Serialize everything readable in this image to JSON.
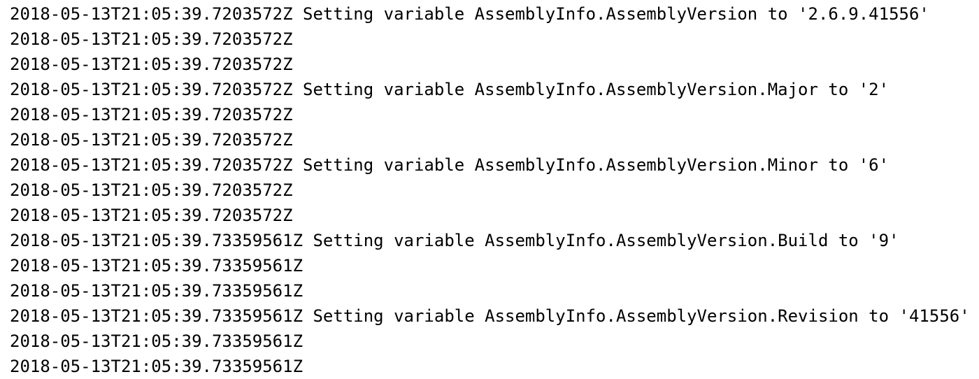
{
  "log": {
    "lines": [
      "2018-05-13T21:05:39.7203572Z Setting variable AssemblyInfo.AssemblyVersion to '2.6.9.41556'",
      "2018-05-13T21:05:39.7203572Z",
      "2018-05-13T21:05:39.7203572Z",
      "2018-05-13T21:05:39.7203572Z Setting variable AssemblyInfo.AssemblyVersion.Major to '2'",
      "2018-05-13T21:05:39.7203572Z",
      "2018-05-13T21:05:39.7203572Z",
      "2018-05-13T21:05:39.7203572Z Setting variable AssemblyInfo.AssemblyVersion.Minor to '6'",
      "2018-05-13T21:05:39.7203572Z",
      "2018-05-13T21:05:39.7203572Z",
      "2018-05-13T21:05:39.73359561Z Setting variable AssemblyInfo.AssemblyVersion.Build to '9'",
      "2018-05-13T21:05:39.73359561Z",
      "2018-05-13T21:05:39.73359561Z",
      "2018-05-13T21:05:39.73359561Z Setting variable AssemblyInfo.AssemblyVersion.Revision to '41556'",
      "2018-05-13T21:05:39.73359561Z",
      "2018-05-13T21:05:39.73359561Z"
    ]
  }
}
